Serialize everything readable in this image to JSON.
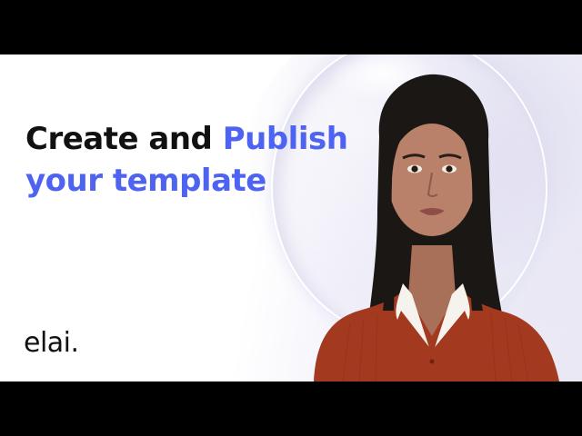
{
  "slide": {
    "headline": {
      "line1_plain": "Create and ",
      "line1_accent": "Publish",
      "line2_accent": "your template"
    },
    "logo_text": "elai."
  },
  "colors": {
    "accent": "#4f63f1",
    "text": "#111111",
    "sweater": "#a33a1f",
    "hair": "#1b1714",
    "skin": "#b9816a",
    "letterbox": "#000000"
  },
  "icons": {
    "presenter": "presenter-avatar-image"
  }
}
